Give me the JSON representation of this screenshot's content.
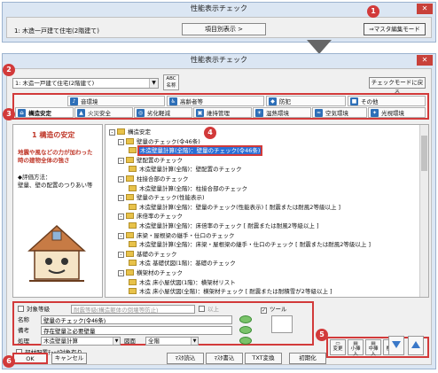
{
  "top_window": {
    "title": "性能表示チェック",
    "close": "✕",
    "plan": "1: 木造一戸建て住宅(2階建て)",
    "item_display_btn": "項目別表示 >",
    "master_edit_btn": "⇒マスタ編集モード"
  },
  "main_window": {
    "title": "性能表示チェック",
    "close": "✕",
    "plan_select": "1: 木造一戸建て住宅(2階建て)",
    "abc_btn": "ABC 名称",
    "back_btn": "チェックモードに戻る"
  },
  "tabs": {
    "row1": [
      {
        "label": "音環境",
        "icon": "sound-icon"
      },
      {
        "label": "高齢者等",
        "icon": "elderly-icon"
      },
      {
        "label": "防犯",
        "icon": "security-icon"
      },
      {
        "label": "その他",
        "icon": "other-icon"
      }
    ],
    "row2": [
      {
        "label": "構造安定",
        "icon": "structure-icon"
      },
      {
        "label": "火災安全",
        "icon": "fire-icon"
      },
      {
        "label": "劣化軽減",
        "icon": "deterioration-icon"
      },
      {
        "label": "維持管理",
        "icon": "maintenance-icon"
      },
      {
        "label": "温熱環境",
        "icon": "thermal-icon"
      },
      {
        "label": "空気環境",
        "icon": "air-icon"
      },
      {
        "label": "光視環境",
        "icon": "light-icon"
      }
    ]
  },
  "description": {
    "heading": "1 構造の安定",
    "lead": "地震や風などの力が加わった時の建物全体の強さ",
    "eval_label": "◆評価方法：",
    "eval_text": "壁量、壁の配置のつりあい等"
  },
  "tree": {
    "nodes": [
      {
        "text": "構造安定",
        "level": 0,
        "pm": "-"
      },
      {
        "text": "壁量のチェック(令46条)",
        "level": 1,
        "pm": "-"
      },
      {
        "text": "木造壁量計算(全階)：壁量のチェック(令46条)",
        "level": 2,
        "pm": "",
        "selected": true
      },
      {
        "text": "壁配置のチェック",
        "level": 1,
        "pm": "-"
      },
      {
        "text": "木造壁量計算(全階)：壁配置のチェック",
        "level": 2,
        "pm": ""
      },
      {
        "text": "柱接合部のチェック",
        "level": 1,
        "pm": "-"
      },
      {
        "text": "木造壁量計算(全階)：柱接合部のチェック",
        "level": 2,
        "pm": ""
      },
      {
        "text": "壁量のチェック(性能表示)",
        "level": 1,
        "pm": "-"
      },
      {
        "text": "木造壁量計算(全階)：壁量のチェック(性能表示) [ 耐震または耐風2等級以上 ]",
        "level": 2,
        "pm": ""
      },
      {
        "text": "床倍率のチェック",
        "level": 1,
        "pm": "-"
      },
      {
        "text": "木造壁量計算(全階)：床倍率のチェック [ 耐震または耐風2等級以上 ]",
        "level": 2,
        "pm": ""
      },
      {
        "text": "床梁・屋根梁の継手・仕口のチェック",
        "level": 1,
        "pm": "-"
      },
      {
        "text": "木造壁量計算(全階)：床梁・屋根梁の継手・仕口のチェック [ 耐震または耐風2等級以上 ]",
        "level": 2,
        "pm": ""
      },
      {
        "text": "基礎のチェック",
        "level": 1,
        "pm": "-"
      },
      {
        "text": "木造 基礎伏図(1階)：基礎のチェック",
        "level": 2,
        "pm": ""
      },
      {
        "text": "横架材のチェック",
        "level": 1,
        "pm": "-"
      },
      {
        "text": "木造 床小屋伏図(1階)：横架材リスト",
        "level": 2,
        "pm": ""
      },
      {
        "text": "木造 床小屋伏図(全階)：横架材チェック [ 耐震または耐積雪が2等級以上 ]",
        "level": 2,
        "pm": ""
      }
    ]
  },
  "form": {
    "target_grade_label": "対象等級",
    "target_grade_value": "耐震等級(構造躯体の倒壊等防止)",
    "or_more": "以上",
    "name_label": "名称",
    "name_value": "壁量のチェック(令46条)",
    "note_label": "備考",
    "note_value": "存在壁量≧必要壁量",
    "process_label": "処理",
    "process_value": "木造壁量計算",
    "drawing_label": "図面",
    "drawing_value": "全階",
    "member_check_label": "部材配置ﾁｪｯｸ対象有り",
    "tool_label": "ツール"
  },
  "edit_buttons": [
    "変更",
    "小挿入",
    "中挿入",
    "削除"
  ],
  "bottom_buttons": {
    "ok": "OK",
    "cancel": "キャンセル",
    "master_read": "ﾏｽﾀ読込",
    "master_write": "ﾏｽﾀ書込",
    "txt_convert": "TXT変換",
    "init": "初期化"
  },
  "callouts": [
    "1",
    "2",
    "3",
    "4",
    "5",
    "6"
  ],
  "colors": {
    "accent": "#d23a3a",
    "selection": "#2a6fd6"
  }
}
